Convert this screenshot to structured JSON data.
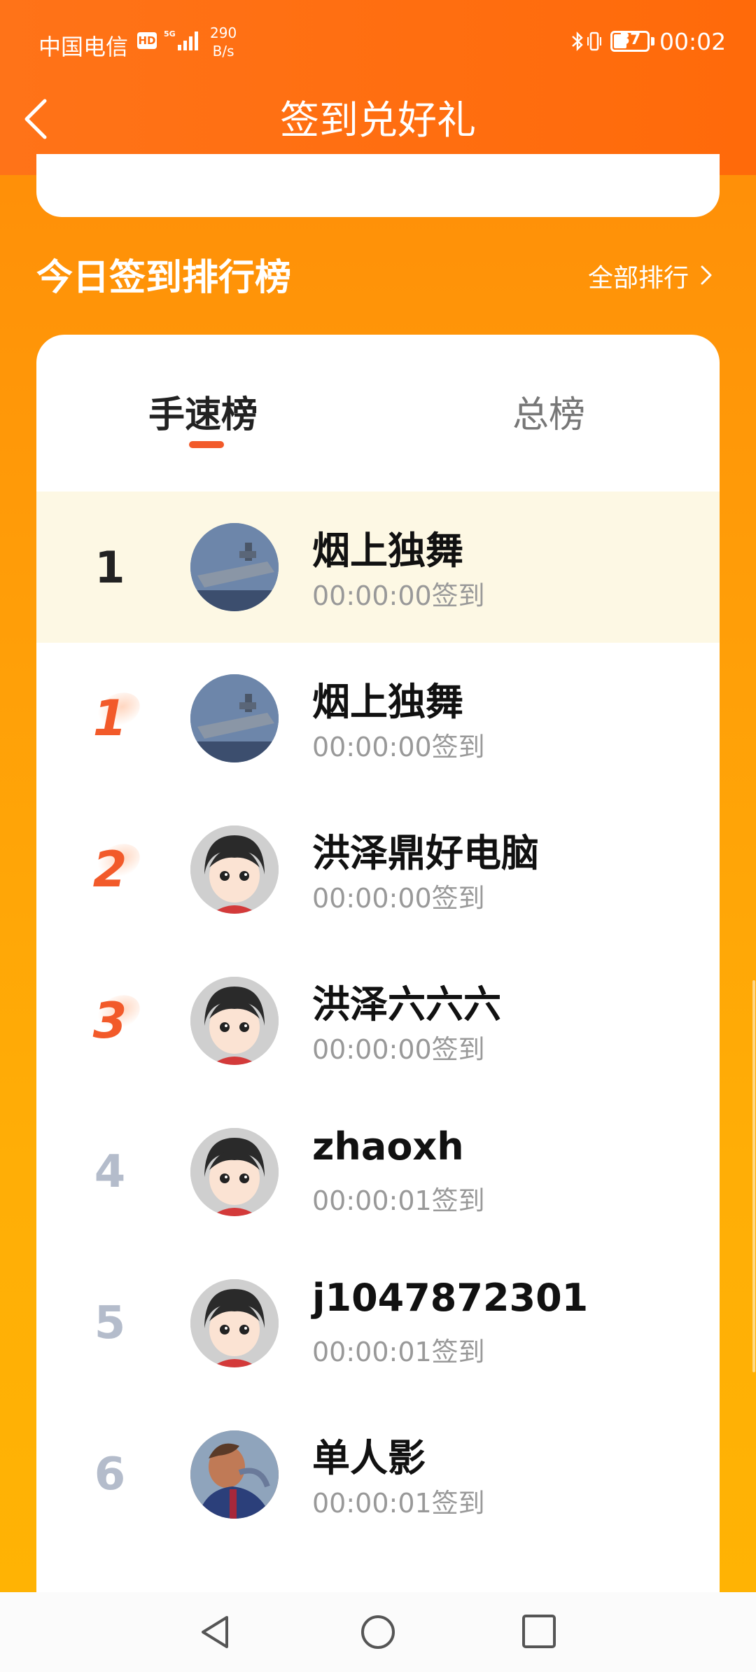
{
  "status_bar": {
    "carrier": "中国电信",
    "hd": "HD",
    "net_speed_value": "290",
    "net_speed_unit": "B/s",
    "battery": "37",
    "time": "00:02"
  },
  "header": {
    "title": "签到兑好礼"
  },
  "section": {
    "title": "今日签到排行榜",
    "all_rank": "全部排行"
  },
  "tabs": [
    {
      "label": "手速榜",
      "active": true
    },
    {
      "label": "总榜",
      "active": false
    }
  ],
  "ranking": [
    {
      "rank": "1",
      "name": "烟上独舞",
      "time": "00:00:00签到",
      "avatar": "aircraft-carrier",
      "highlight": true
    },
    {
      "rank": "1",
      "name": "烟上独舞",
      "time": "00:00:00签到",
      "avatar": "aircraft-carrier"
    },
    {
      "rank": "2",
      "name": "洪泽鼎好电脑",
      "time": "00:00:00签到",
      "avatar": "cartoon-kid"
    },
    {
      "rank": "3",
      "name": "洪泽六六六",
      "time": "00:00:00签到",
      "avatar": "cartoon-kid"
    },
    {
      "rank": "4",
      "name": "zhaoxh",
      "time": "00:00:01签到",
      "avatar": "cartoon-kid"
    },
    {
      "rank": "5",
      "name": "j1047872301",
      "time": "00:00:01签到",
      "avatar": "cartoon-kid"
    },
    {
      "rank": "6",
      "name": "单人影",
      "time": "00:00:01签到",
      "avatar": "football-player"
    }
  ],
  "colors": {
    "header": "#ff6a0a",
    "background_top": "#ff8a08",
    "background_bottom": "#ffb404",
    "accent": "#f25a2a",
    "highlight_row": "#fdf8e4"
  }
}
